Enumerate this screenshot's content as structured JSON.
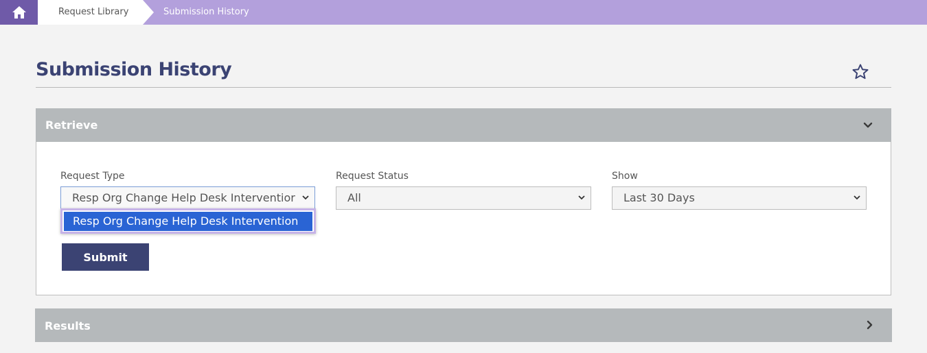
{
  "breadcrumb": {
    "home_icon": "home-icon",
    "items": [
      {
        "label": "Request Library"
      },
      {
        "label": "Submission History"
      }
    ]
  },
  "page": {
    "title": "Submission History",
    "favorite_icon": "star-outline-icon"
  },
  "retrieve": {
    "header": "Retrieve",
    "toggle_icon": "chevron-down-icon",
    "request_type": {
      "label": "Request Type",
      "value": "Resp Org Change Help Desk Interventior",
      "options": [
        "Resp Org Change Help Desk Intervention"
      ]
    },
    "request_status": {
      "label": "Request Status",
      "value": "All"
    },
    "show": {
      "label": "Show",
      "value": "Last 30 Days"
    },
    "submit_label": "Submit"
  },
  "results": {
    "header": "Results",
    "toggle_icon": "chevron-right-icon"
  },
  "colors": {
    "breadcrumb_bar": "#b3a0dc",
    "home_tile": "#6f5aa8",
    "title": "#3b4373",
    "panel_header": "#b5b9bb",
    "submit_button": "#3b4373",
    "option_highlight": "#2a64d4"
  }
}
